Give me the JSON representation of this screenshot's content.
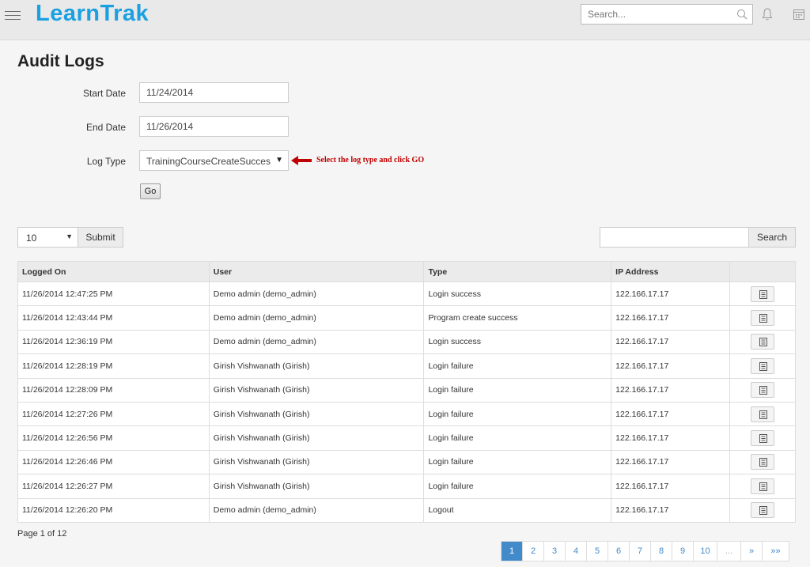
{
  "header": {
    "logo": "LearnTrak",
    "search_placeholder": "Search..."
  },
  "page": {
    "title": "Audit Logs"
  },
  "form": {
    "start_date_label": "Start Date",
    "start_date_value": "11/24/2014",
    "end_date_label": "End Date",
    "end_date_value": "11/26/2014",
    "log_type_label": "Log Type",
    "log_type_value": "TrainingCourseCreateSucces",
    "annotation": "Select the log type and  click GO",
    "go_label": "Go"
  },
  "controls": {
    "page_size": "10",
    "submit_label": "Submit",
    "search_label": "Search"
  },
  "table": {
    "headers": [
      "Logged On",
      "User",
      "Type",
      "IP Address",
      ""
    ],
    "rows": [
      [
        "11/26/2014 12:47:25 PM",
        "Demo admin (demo_admin)",
        "Login success",
        "122.166.17.17"
      ],
      [
        "11/26/2014 12:43:44 PM",
        "Demo admin (demo_admin)",
        "Program create success",
        "122.166.17.17"
      ],
      [
        "11/26/2014 12:36:19 PM",
        "Demo admin (demo_admin)",
        "Login success",
        "122.166.17.17"
      ],
      [
        "11/26/2014 12:28:19 PM",
        "Girish Vishwanath (Girish)",
        "Login failure",
        "122.166.17.17"
      ],
      [
        "11/26/2014 12:28:09 PM",
        "Girish Vishwanath (Girish)",
        "Login failure",
        "122.166.17.17"
      ],
      [
        "11/26/2014 12:27:26 PM",
        "Girish Vishwanath (Girish)",
        "Login failure",
        "122.166.17.17"
      ],
      [
        "11/26/2014 12:26:56 PM",
        "Girish Vishwanath (Girish)",
        "Login failure",
        "122.166.17.17"
      ],
      [
        "11/26/2014 12:26:46 PM",
        "Girish Vishwanath (Girish)",
        "Login failure",
        "122.166.17.17"
      ],
      [
        "11/26/2014 12:26:27 PM",
        "Girish Vishwanath (Girish)",
        "Login failure",
        "122.166.17.17"
      ],
      [
        "11/26/2014 12:26:20 PM",
        "Demo admin (demo_admin)",
        "Logout",
        "122.166.17.17"
      ]
    ]
  },
  "pagination": {
    "info": "Page 1 of 12",
    "pages": [
      "1",
      "2",
      "3",
      "4",
      "5",
      "6",
      "7",
      "8",
      "9",
      "10",
      "...",
      "»",
      "»»"
    ],
    "active": "1"
  },
  "colors": {
    "brand": "#1ba1e2",
    "active_page": "#428bca",
    "annotation": "#c00000"
  }
}
